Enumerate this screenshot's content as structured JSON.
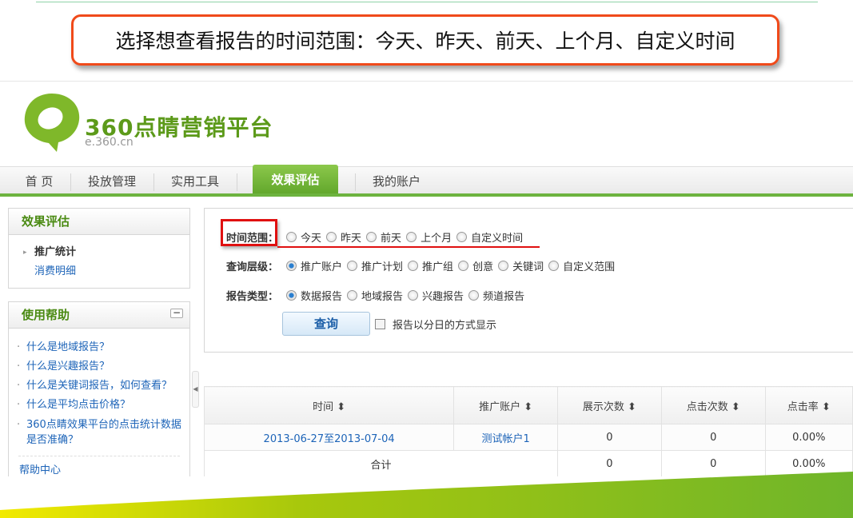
{
  "callout": "选择想查看报告的时间范围：今天、昨天、前天、上个月、自定义时间",
  "brand": {
    "name": "360点睛营销平台",
    "domain": "e.360.cn",
    "color": "#5c9a1a"
  },
  "nav": {
    "items": [
      "首 页",
      "投放管理",
      "实用工具",
      "效果评估",
      "我的账户"
    ],
    "active": "效果评估"
  },
  "sidebar": {
    "panel1": {
      "title": "效果评估",
      "items": [
        "推广统计",
        "消费明细"
      ]
    },
    "panel2": {
      "title": "使用帮助",
      "links": [
        "什么是地域报告？",
        "什么是兴趣报告？",
        "什么是关键词报告，如何查看？",
        "什么是平均点击价格？",
        "360点睛效果平台的点击统计数据是否准确？"
      ],
      "footer": "帮助中心"
    }
  },
  "filter": {
    "time": {
      "label": "时间范围：",
      "options": [
        "今天",
        "昨天",
        "前天",
        "上个月",
        "自定义时间"
      ],
      "selected": null
    },
    "level": {
      "label": "查询层级：",
      "options": [
        "推广账户",
        "推广计划",
        "推广组",
        "创意",
        "关键词",
        "自定义范围"
      ],
      "selected": "推广账户"
    },
    "type": {
      "label": "报告类型：",
      "options": [
        "数据报告",
        "地域报告",
        "兴趣报告",
        "频道报告"
      ],
      "selected": "数据报告"
    },
    "query_button": "查询",
    "daily_checkbox": {
      "label": "报告以分日的方式显示",
      "checked": false
    }
  },
  "table": {
    "headers": [
      "时间",
      "推广账户",
      "展示次数",
      "点击次数",
      "点击率"
    ],
    "rows": [
      [
        "2013-06-27至2013-07-04",
        "测试帐户1",
        "0",
        "0",
        "0.00%"
      ]
    ],
    "total": {
      "label": "合计",
      "impressions": "0",
      "clicks": "0",
      "ctr": "0.00%"
    }
  },
  "colors": {
    "accent_green": "#6db33f",
    "highlight_red": "#e01010",
    "callout_border": "#f04a1a",
    "link": "#1d64b8"
  }
}
